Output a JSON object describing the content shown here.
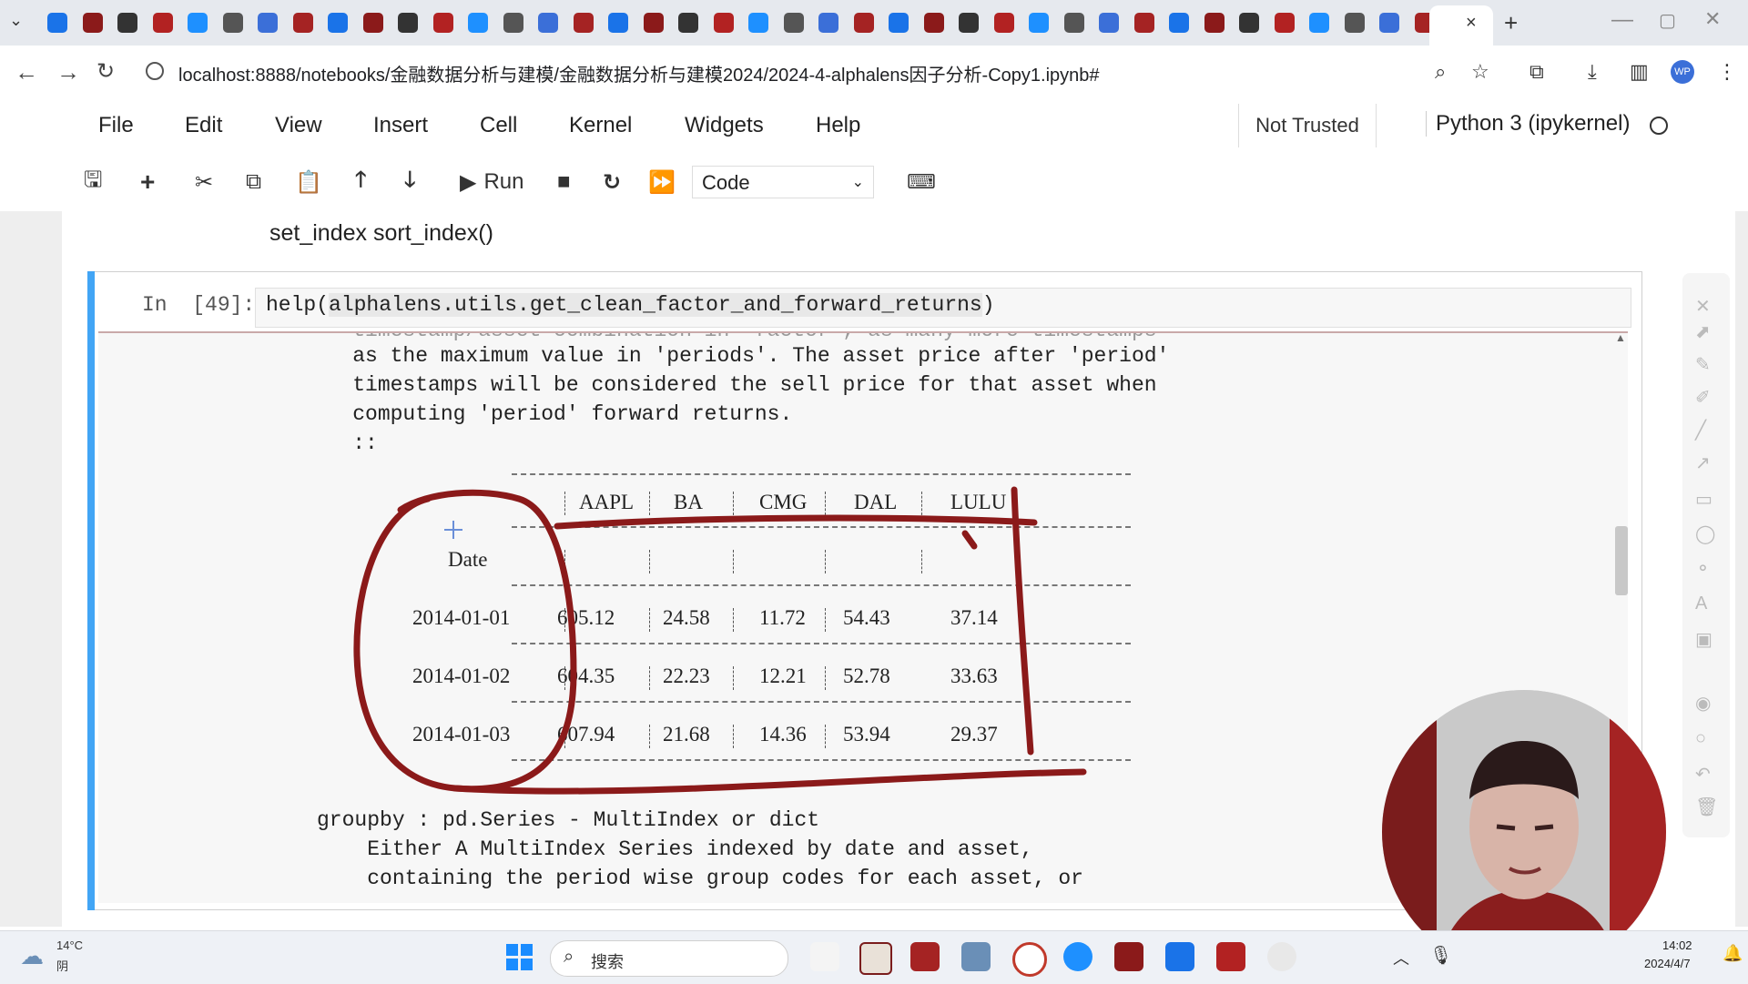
{
  "browser": {
    "url": "localhost:8888/notebooks/金融数据分析与建模/金融数据分析与建模2024/2024-4-alphalens因子分析-Copy1.ipynb#",
    "tab_close": "×",
    "new_tab": "+",
    "favicon_count": 40
  },
  "menu": {
    "items": [
      "File",
      "Edit",
      "View",
      "Insert",
      "Cell",
      "Kernel",
      "Widgets",
      "Help"
    ],
    "trust": "Not Trusted",
    "kernel": "Python 3 (ipykernel)"
  },
  "toolbar": {
    "run_label": "Run",
    "cell_type": "Code"
  },
  "notebook": {
    "markdown_text": "set_index sort_index()",
    "prompt": "In  [49]:",
    "input_code_prefix": "help(",
    "input_code_highlight": "alphalens.utils.get_clean_factor_and_forward_returns",
    "input_code_suffix": ")",
    "output_lines_top": [
      "    timestamp/asset combination in 'factor', as many more timestamps",
      "    as the maximum value in 'periods'. The asset price after 'period'",
      "    timestamps will be considered the sell price for that asset when",
      "    computing 'period' forward returns.",
      "    ::"
    ],
    "table": {
      "columns": [
        "AAPL",
        "BA",
        "CMG",
        "DAL",
        "LULU"
      ],
      "index_name": "Date",
      "rows": [
        {
          "date": "2014-01-01",
          "values": [
            "605.12",
            "24.58",
            "11.72",
            "54.43",
            "37.14"
          ]
        },
        {
          "date": "2014-01-02",
          "values": [
            "604.35",
            "22.23",
            "12.21",
            "52.78",
            "33.63"
          ]
        },
        {
          "date": "2014-01-03",
          "values": [
            "607.94",
            "21.68",
            "14.36",
            "53.94",
            "29.37"
          ]
        }
      ]
    },
    "output_lines_bottom": [
      "groupby : pd.Series - MultiIndex or dict",
      "    Either A MultiIndex Series indexed by date and asset,",
      "    containing the period wise group codes for each asset, or"
    ]
  },
  "taskbar": {
    "weather_temp": "14°C",
    "weather_desc": "阴",
    "search_placeholder": "搜索",
    "time": "14:02",
    "date": "2024/4/7"
  },
  "colors": {
    "cell_accent": "#42a5f5",
    "annotation": "#8b1a1a",
    "webcam_tint": "#8a1e1e"
  }
}
